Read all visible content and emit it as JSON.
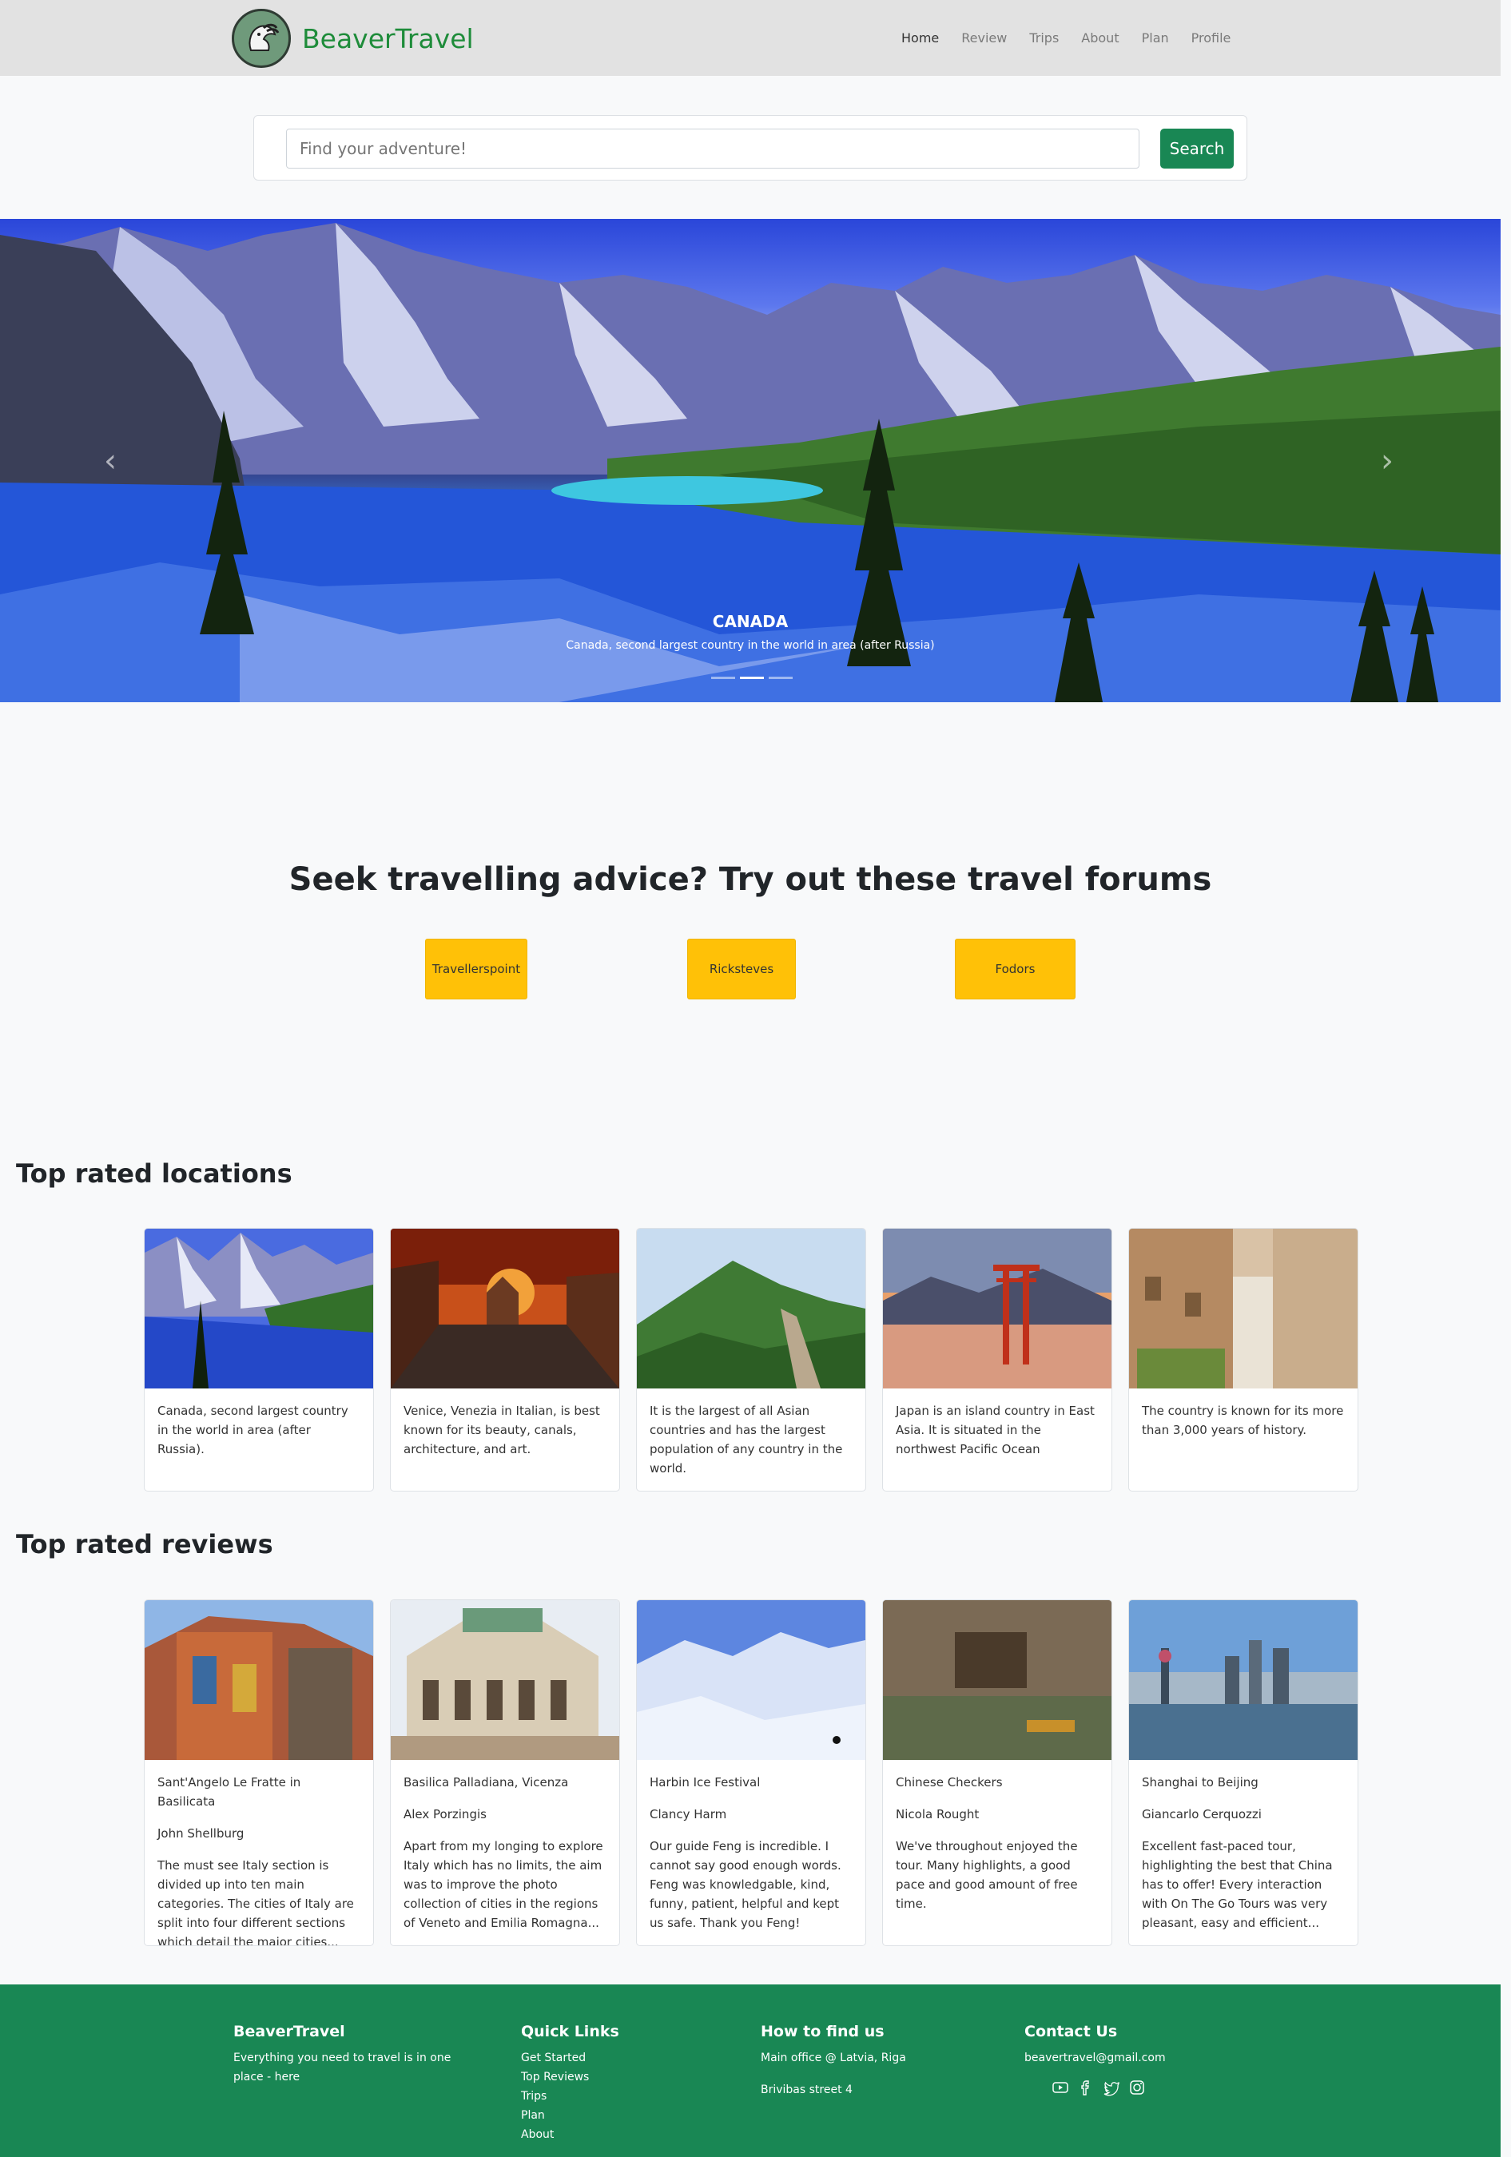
{
  "nav": {
    "brand": "BeaverTravel",
    "links": [
      "Home",
      "Review",
      "Trips",
      "About",
      "Plan",
      "Profile"
    ]
  },
  "search": {
    "placeholder": "Find your adventure!",
    "button": "Search"
  },
  "carousel": {
    "title": "CANADA",
    "text": "Canada, second largest country in the world in area (after Russia)",
    "prev_icon": "chevron-left-icon",
    "next_icon": "chevron-right-icon",
    "active_slide": 2,
    "slide_count": 3
  },
  "forums": {
    "heading": "Seek travelling advice? Try out these travel forums",
    "buttons": [
      "Travellerspoint",
      "Ricksteves",
      "Fodors"
    ]
  },
  "locations": {
    "title": "Top rated locations",
    "cards": [
      {
        "text": "Canada, second largest country in the world in area (after Russia)."
      },
      {
        "text": "Venice, Venezia in Italian, is best known for its beauty, canals, architecture, and art."
      },
      {
        "text": "It is the largest of all Asian countries and has the largest population of any country in the world."
      },
      {
        "text": "Japan is an island country in East Asia. It is situated in the northwest Pacific Ocean"
      },
      {
        "text": "The country is known for its more than 3,000 years of history."
      }
    ]
  },
  "reviews": {
    "title": "Top rated reviews",
    "cards": [
      {
        "place": "Sant'Angelo Le Fratte in Basilicata",
        "author": "John Shellburg",
        "text": "The must see Italy section is divided up into ten main categories. The cities of Italy are split into four different sections which detail the major cities..."
      },
      {
        "place": "Basilica Palladiana, Vicenza",
        "author": "Alex Porzingis",
        "text": "Apart from my longing to explore Italy which has no limits, the aim was to improve the photo collection of cities in the regions of Veneto and Emilia Romagna..."
      },
      {
        "place": "Harbin Ice Festival",
        "author": "Clancy Harm",
        "text": "Our guide Feng is incredible. I cannot say good enough words. Feng was knowledgable, kind, funny, patient, helpful and kept us safe. Thank you Feng!"
      },
      {
        "place": "Chinese Checkers",
        "author": "Nicola Rought",
        "text": "We've throughout enjoyed the tour. Many highlights, a good pace and good amount of free time."
      },
      {
        "place": "Shanghai to Beijing",
        "author": "Giancarlo Cerquozzi",
        "text": "Excellent fast-paced tour, highlighting the best that China has to offer! Every interaction with On The Go Tours was very pleasant, easy and efficient..."
      }
    ]
  },
  "footer": {
    "brand": {
      "title": "BeaverTravel",
      "text": "Everything you need to travel is in one place - here"
    },
    "quick_links": {
      "title": "Quick Links",
      "items": [
        "Get Started",
        "Top Reviews",
        "Trips",
        "Plan",
        "About"
      ]
    },
    "find_us": {
      "title": "How to find us",
      "line1": "Main office @ Latvia, Riga",
      "line2": "Brivibas street 4"
    },
    "contact": {
      "title": "Contact Us",
      "email": "beavertravel@gmail.com",
      "socials": [
        "youtube-icon",
        "facebook-icon",
        "twitter-icon",
        "instagram-icon"
      ]
    }
  },
  "colors": {
    "brand_green": "#198754",
    "forum_yellow": "#ffc107",
    "navbar_bg": "#e2e2e2"
  }
}
